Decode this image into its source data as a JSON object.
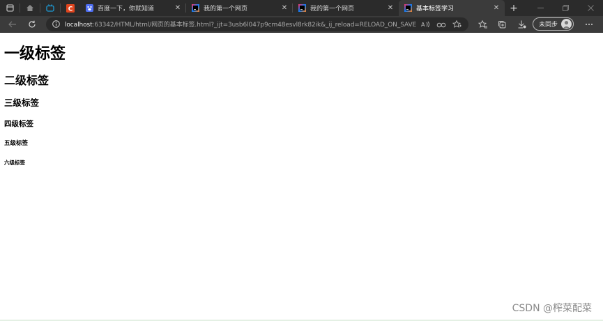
{
  "tabs": [
    {
      "title": "百度一下，你就知道",
      "icon": "baidu-icon"
    },
    {
      "title": "我的第一个网页",
      "icon": "intellij-icon"
    },
    {
      "title": "我的第一个网页",
      "icon": "intellij-icon"
    },
    {
      "title": "基本标签学习",
      "icon": "intellij-icon",
      "active": true
    }
  ],
  "tab_close": "✕",
  "new_tab": "+",
  "address": {
    "host": "localhost",
    "rest": ":63342/HTML/html/网页的基本标签.html?_ijt=3usb6l047p9cm48esvl8rk82ik&_ij_reload=RELOAD_ON_SAVE"
  },
  "sync": {
    "label": "未同步"
  },
  "page": {
    "h1": "一级标签",
    "h2": "二级标签",
    "h3": "三级标签",
    "h4": "四级标签",
    "h5": "五级标签",
    "h6": "六级标签"
  },
  "watermark": "CSDN @榨菜配菜",
  "colors": {
    "tab_strip": "#2b2b2b",
    "toolbar": "#3b3b3b",
    "address_bar": "#2a2a2a",
    "page_background": "#ffffff"
  }
}
